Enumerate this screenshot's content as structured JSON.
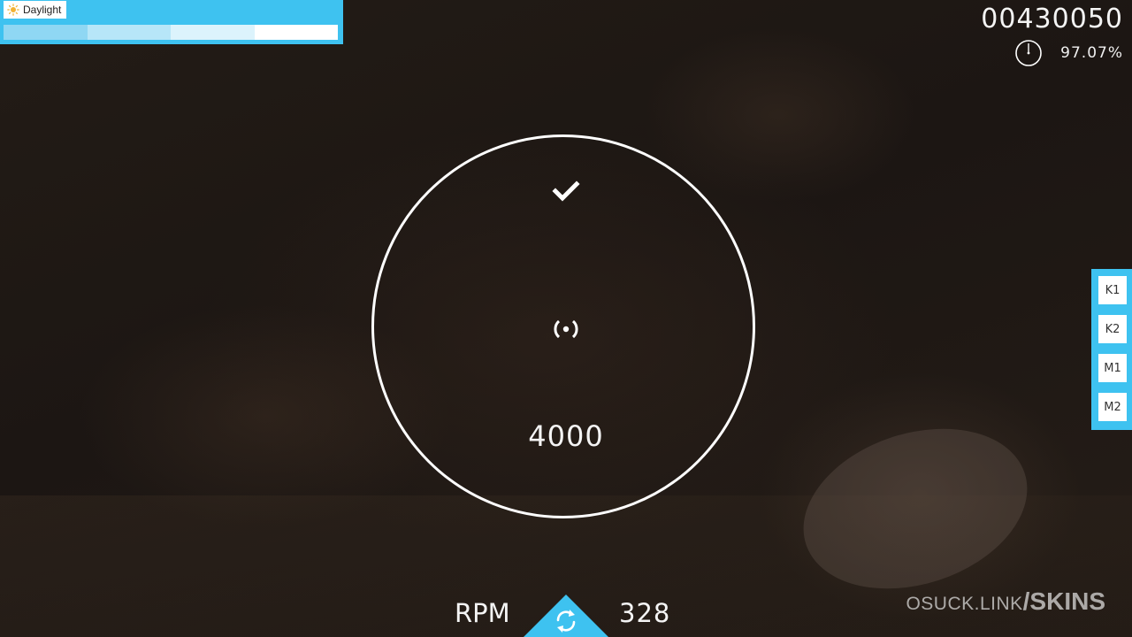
{
  "song_bar": {
    "label": "Daylight",
    "icon": "sun-icon",
    "progress": 1.0,
    "segment_colors": [
      "#8fd7f3",
      "#b7e6f8",
      "#dcf3fc",
      "#ffffff"
    ]
  },
  "score": {
    "value": "00430050",
    "accuracy": "97.07%",
    "progress_icon": "progress-pie-icon"
  },
  "spinner": {
    "status_icon": "check-icon",
    "center_icon": "spinner-center-icon",
    "bonus": "4000"
  },
  "rpm": {
    "label": "RPM",
    "value": "328",
    "icon": "spin-arrows-icon"
  },
  "keys": [
    "K1",
    "K2",
    "M1",
    "M2"
  ],
  "watermark": {
    "prefix": "OSUCK.LINK",
    "suffix": "/SKINS"
  },
  "colors": {
    "accent": "#3ec2f0",
    "text": "#f4f4f4"
  }
}
